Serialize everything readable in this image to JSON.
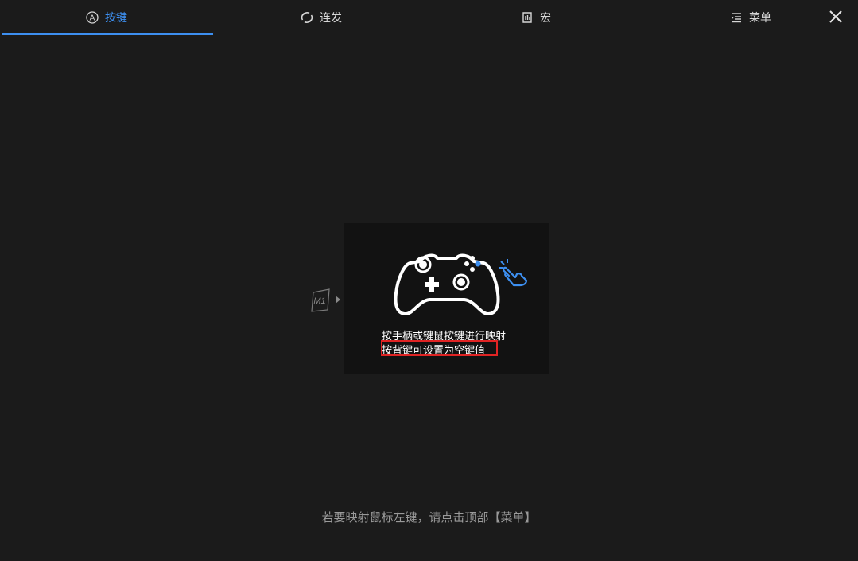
{
  "tabs": [
    {
      "label": "按键",
      "icon": "a-circle-icon",
      "active": true
    },
    {
      "label": "连发",
      "icon": "burst-icon",
      "active": false
    },
    {
      "label": "宏",
      "icon": "macro-icon",
      "active": false
    },
    {
      "label": "菜单",
      "icon": "menu-icon",
      "active": false
    }
  ],
  "close_icon": "close-icon",
  "mapping": {
    "slot_label": "M1",
    "line1": "按手柄或键鼠按键进行映射",
    "line2": "按背键可设置为空键值"
  },
  "hint": "若要映射鼠标左键，请点击顶部【菜单】",
  "colors": {
    "accent": "#3d8ff0",
    "background": "#1b1b1b",
    "card": "#121212",
    "highlight_box": "#e02424"
  }
}
